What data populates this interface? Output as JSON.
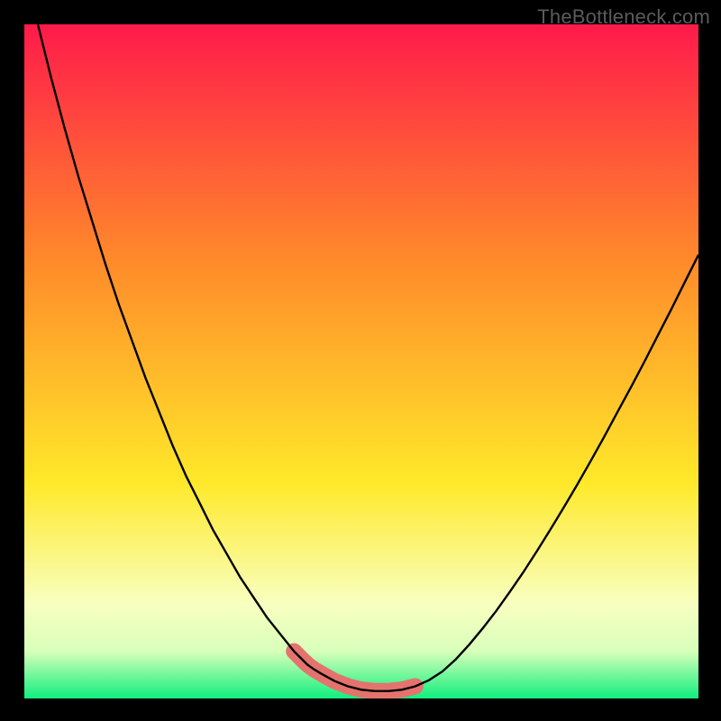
{
  "attribution": "TheBottleneck.com",
  "colors": {
    "gradient_top": "#ff1a4b",
    "gradient_mid1": "#ff6a2a",
    "gradient_mid2": "#ffe92a",
    "gradient_low": "#f6ffb3",
    "gradient_green": "#10ef7e",
    "curve": "#000000",
    "coral": "#e4736d",
    "frame": "#000000"
  },
  "chart_data": {
    "type": "line",
    "title": "",
    "xlabel": "",
    "ylabel": "",
    "xlim": [
      0,
      100
    ],
    "ylim": [
      0,
      100
    ],
    "x": [
      0,
      2,
      4,
      6,
      8,
      10,
      12,
      14,
      16,
      18,
      20,
      22,
      24,
      26,
      28,
      30,
      32,
      34,
      36,
      38,
      40,
      41,
      42,
      43,
      44,
      46,
      48,
      50,
      52,
      54,
      56,
      58,
      60,
      62,
      64,
      66,
      68,
      70,
      72,
      74,
      76,
      78,
      80,
      82,
      84,
      86,
      88,
      90,
      92,
      94,
      96,
      98,
      100
    ],
    "values": [
      110,
      100,
      92,
      84.5,
      77.5,
      71,
      64.5,
      58.5,
      53,
      47.5,
      42.5,
      37.5,
      33,
      29,
      25,
      21.5,
      18,
      15,
      12,
      9.5,
      7,
      6,
      5,
      4.3,
      3.7,
      2.6,
      1.8,
      1.3,
      1.1,
      1.1,
      1.3,
      1.8,
      2.7,
      4,
      5.8,
      8,
      10.4,
      13,
      15.8,
      18.7,
      21.8,
      25,
      28.3,
      31.7,
      35.2,
      38.8,
      42.5,
      46.2,
      50,
      53.9,
      57.8,
      61.8,
      65.8
    ],
    "highlight_band": {
      "xstart": 40,
      "xend": 58,
      "y": 1.2
    }
  }
}
